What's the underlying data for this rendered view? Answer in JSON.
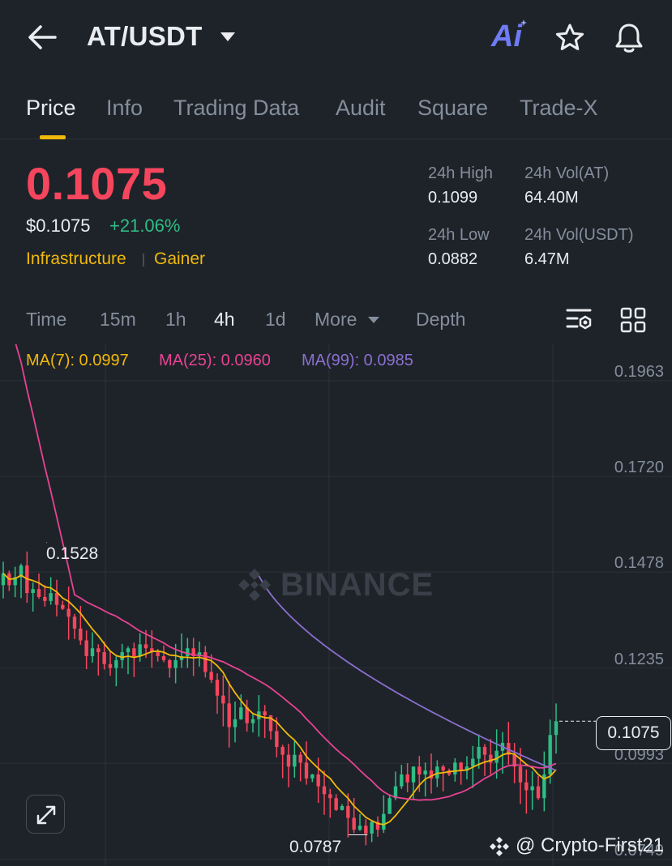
{
  "header": {
    "pair": "AT/USDT",
    "ai_label": "Ai",
    "back_icon": "arrow-left-icon",
    "star_icon": "star-icon",
    "bell_icon": "bell-icon"
  },
  "tabs": [
    {
      "label": "Price",
      "active": true
    },
    {
      "label": "Info"
    },
    {
      "label": "Trading Data"
    },
    {
      "label": "Audit"
    },
    {
      "label": "Square"
    },
    {
      "label": "Trade-X"
    }
  ],
  "ticker": {
    "last_price": "0.1075",
    "usd_price": "$0.1075",
    "change": "+21.06%",
    "tags": [
      "Infrastructure",
      "Gainer"
    ],
    "stats": {
      "high_label": "24h High",
      "high_value": "0.1099",
      "vol_base_label": "24h Vol(AT)",
      "vol_base_value": "64.40M",
      "low_label": "24h Low",
      "low_value": "0.0882",
      "vol_quote_label": "24h Vol(USDT)",
      "vol_quote_value": "6.47M"
    }
  },
  "timeframes": {
    "items": [
      "Time",
      "15m",
      "1h",
      "4h",
      "1d",
      "More",
      "Depth"
    ],
    "selected": "4h",
    "chart_settings_icon": "chart-settings-icon",
    "grid_icon": "grid-icon"
  },
  "indicators": {
    "ma7": "MA(7): 0.0997",
    "ma25": "MA(25): 0.0960",
    "ma99": "MA(99): 0.0985"
  },
  "chart": {
    "y_ticks": [
      "0.1963",
      "0.1720",
      "0.1478",
      "0.1235",
      "0.0993",
      "0.0749"
    ],
    "last_price_tag": "0.1075",
    "high_marker": "0.1528",
    "low_marker": "0.0787",
    "watermark": "BINANCE",
    "expand_icon": "expand-icon",
    "credit": "@ Crypto-First21"
  },
  "colors": {
    "up": "#2ebd85",
    "down": "#f6465d",
    "accent": "#f0b90b",
    "ma7": "#f0b90b",
    "ma25": "#e84393",
    "ma99": "#8b6fd1"
  },
  "chart_data": {
    "type": "candlestick",
    "ylim": [
      0.0749,
      0.1963
    ],
    "y_ticks": [
      0.1963,
      0.172,
      0.1478,
      0.1235,
      0.0993,
      0.0749
    ],
    "last": 0.1075,
    "high_marker": 0.1528,
    "low_marker": 0.0787,
    "ma_close": [
      0.145,
      0.142,
      0.144,
      0.147,
      0.14,
      0.141,
      0.139,
      0.138,
      0.14,
      0.137,
      0.136,
      0.134,
      0.131,
      0.128,
      0.124,
      0.126,
      0.125,
      0.122,
      0.121,
      0.123,
      0.125,
      0.126,
      0.124,
      0.127,
      0.126,
      0.125,
      0.124,
      0.123,
      0.121,
      0.123,
      0.124,
      0.126,
      0.124,
      0.125,
      0.12,
      0.118,
      0.114,
      0.112,
      0.106,
      0.108,
      0.111,
      0.107,
      0.108,
      0.11,
      0.109,
      0.105,
      0.101,
      0.099,
      0.096,
      0.099,
      0.097,
      0.093,
      0.094,
      0.091,
      0.089,
      0.088,
      0.085,
      0.086,
      0.083,
      0.08,
      0.081,
      0.079,
      0.082,
      0.08,
      0.084,
      0.088,
      0.091,
      0.094,
      0.092,
      0.096,
      0.094,
      0.095,
      0.093,
      0.096,
      0.095,
      0.094,
      0.097,
      0.095,
      0.096,
      0.098,
      0.101,
      0.099,
      0.097,
      0.1,
      0.102,
      0.099,
      0.096,
      0.092,
      0.09,
      0.091,
      0.088,
      0.094,
      0.104,
      0.1075
    ],
    "series": [
      {
        "name": "MA(7)",
        "last": 0.0997
      },
      {
        "name": "MA(25)",
        "last": 0.096
      },
      {
        "name": "MA(99)",
        "last": 0.0985
      }
    ]
  }
}
